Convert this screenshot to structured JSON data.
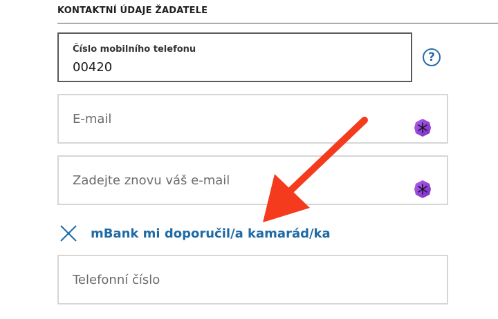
{
  "section": {
    "title": "KONTAKTNÍ ÚDAJE ŽADATELE"
  },
  "phone": {
    "label": "Číslo mobilního telefonu",
    "value": "00420"
  },
  "help": {
    "glyph": "?",
    "icon": "question-circle-icon"
  },
  "email": {
    "placeholder": "E-mail",
    "icon": "password-manager-icon"
  },
  "email_confirm": {
    "placeholder": "Zadejte znovu váš e-mail",
    "icon": "password-manager-icon"
  },
  "referral": {
    "label": "mBank mi doporučil/a kamarád/ka",
    "icon": "close-x-icon"
  },
  "referrer_phone": {
    "placeholder": "Telefonní číslo"
  },
  "colors": {
    "accent": "#1f6aa5",
    "annotation_arrow": "#f43b1e",
    "pm_icon_purple": "#8a3fd1"
  }
}
